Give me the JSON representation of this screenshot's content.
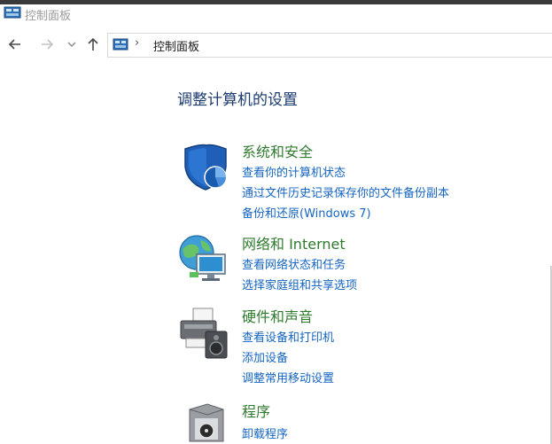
{
  "window": {
    "title": "控制面板"
  },
  "address_bar": {
    "path_label": "控制面板"
  },
  "main": {
    "heading": "调整计算机的设置",
    "categories": [
      {
        "title": "系统和安全",
        "icon": "shield-icon",
        "links": [
          "查看你的计算机状态",
          "通过文件历史记录保存你的文件备份副本",
          "备份和还原(Windows 7)"
        ]
      },
      {
        "title": "网络和 Internet",
        "icon": "network-globe-icon",
        "links": [
          "查看网络状态和任务",
          "选择家庭组和共享选项"
        ]
      },
      {
        "title": "硬件和声音",
        "icon": "printer-speaker-icon",
        "links": [
          "查看设备和打印机",
          "添加设备",
          "调整常用移动设置"
        ]
      },
      {
        "title": "程序",
        "icon": "programs-box-icon",
        "links": [
          "卸载程序"
        ]
      }
    ]
  },
  "colors": {
    "category_title": "#2f7a2f",
    "link": "#1565c0",
    "heading": "#1a3a6e"
  }
}
